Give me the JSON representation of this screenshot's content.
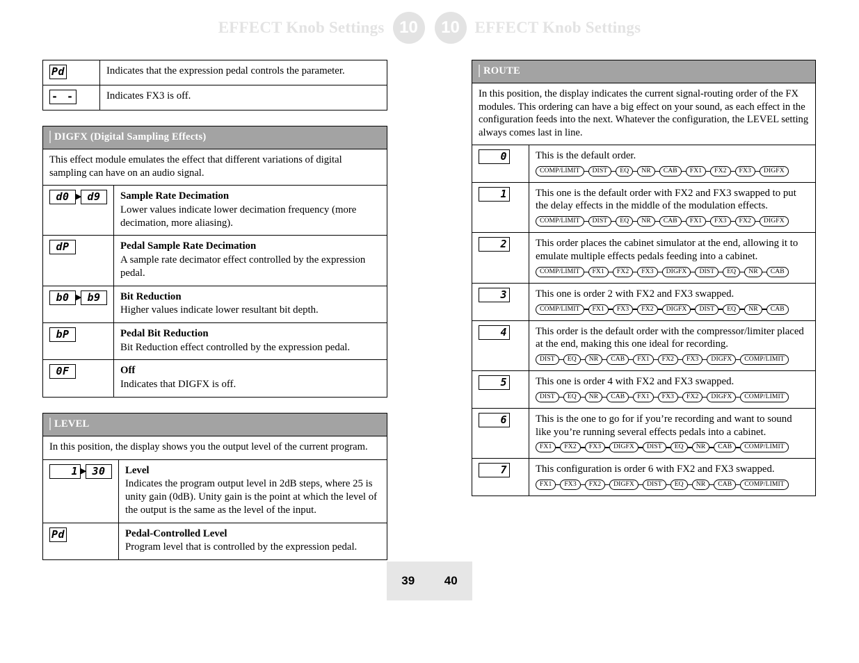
{
  "header": {
    "left_title": "EFFECT Knob Settings",
    "right_title": "EFFECT Knob Settings",
    "badge_left": "10",
    "badge_right": "10",
    "badge_color": "#e3e3e3",
    "title_color": "#e3e3e3"
  },
  "footer": {
    "page_left": "39",
    "page_right": "40",
    "background": "#e6e6e6"
  },
  "left_column": {
    "top_table": {
      "rows": [
        {
          "symbol": "Pd",
          "symbol_type": "single",
          "description": "Indicates that the expression pedal controls the parameter."
        },
        {
          "symbol": "- -",
          "symbol_type": "dashes",
          "description": "Indicates FX3 is off."
        }
      ]
    },
    "digfx": {
      "heading": "DIGFX (Digital Sampling Effects)",
      "heading_bg": "#a3a3a3",
      "intro": "This effect module emulates the effect that different variations of digital sampling can have on an audio signal.",
      "rows": [
        {
          "symbol_from": "d0",
          "symbol_to": "d9",
          "symbol_type": "range",
          "term": "Sample Rate Decimation",
          "desc": "Lower values indicate lower decimation frequency (more decimation, more aliasing)."
        },
        {
          "symbol": "dP",
          "symbol_type": "single",
          "term": "Pedal Sample Rate Decimation",
          "desc": "A sample rate decimator effect controlled by the expression pedal."
        },
        {
          "symbol_from": "b0",
          "symbol_to": "b9",
          "symbol_type": "range",
          "term": "Bit Reduction",
          "desc": "Higher values indicate lower resultant bit depth."
        },
        {
          "symbol": "bP",
          "symbol_type": "single",
          "term": "Pedal Bit Reduction",
          "desc": "Bit Reduction effect controlled by the expression pedal."
        },
        {
          "symbol": "0F",
          "symbol_type": "single",
          "term": "Off",
          "desc": "Indicates that DIGFX is off."
        }
      ]
    },
    "level": {
      "heading": "LEVEL",
      "heading_bg": "#a3a3a3",
      "intro": "In this position, the display shows you the output level of the current program.",
      "rows": [
        {
          "symbol_from": "1",
          "symbol_to": "30",
          "symbol_type": "range_padded",
          "term": "Level",
          "desc": "Indicates the program output level in 2dB steps, where 25 is unity gain (0dB). Unity gain is the point at which the level of the output is the same as the level of the input."
        },
        {
          "symbol": "Pd",
          "symbol_type": "single",
          "term": "Pedal-Controlled Level",
          "desc": "Program level that is controlled by the expression pedal."
        }
      ]
    }
  },
  "right_column": {
    "route": {
      "heading": "ROUTE",
      "heading_bg": "#a3a3a3",
      "intro": "In this position, the display indicates the current signal-routing order of the FX modules. This ordering can have a big effect on your sound, as each effect in the configuration feeds into the next. Whatever the configuration, the LEVEL setting always comes last in line.",
      "rows": [
        {
          "symbol": "0",
          "desc": "This is the default order.",
          "chain": [
            "COMP/LIMIT",
            "DIST",
            "EQ",
            "NR",
            "CAB",
            "FX1",
            "FX2",
            "FX3",
            "DIGFX"
          ]
        },
        {
          "symbol": "1",
          "desc": "This one is the default order with FX2 and FX3 swapped to put the delay effects in the middle of the modulation effects.",
          "chain": [
            "COMP/LIMIT",
            "DIST",
            "EQ",
            "NR",
            "CAB",
            "FX1",
            "FX3",
            "FX2",
            "DIGFX"
          ]
        },
        {
          "symbol": "2",
          "desc": "This order places the cabinet simulator at the end, allowing it to emulate multiple effects pedals feeding into a cabinet.",
          "chain": [
            "COMP/LIMIT",
            "FX1",
            "FX2",
            "FX3",
            "DIGFX",
            "DIST",
            "EQ",
            "NR",
            "CAB"
          ]
        },
        {
          "symbol": "3",
          "desc": "This one is order 2 with FX2 and FX3 swapped.",
          "chain": [
            "COMP/LIMIT",
            "FX1",
            "FX3",
            "FX2",
            "DIGFX",
            "DIST",
            "EQ",
            "NR",
            "CAB"
          ]
        },
        {
          "symbol": "4",
          "desc": "This order is the default order with the compressor/limiter placed at the end, making this one ideal for recording.",
          "chain": [
            "DIST",
            "EQ",
            "NR",
            "CAB",
            "FX1",
            "FX2",
            "FX3",
            "DIGFX",
            "COMP/LIMIT"
          ]
        },
        {
          "symbol": "5",
          "desc": "This one is order 4 with FX2 and FX3 swapped.",
          "chain": [
            "DIST",
            "EQ",
            "NR",
            "CAB",
            "FX1",
            "FX3",
            "FX2",
            "DIGFX",
            "COMP/LIMIT"
          ]
        },
        {
          "symbol": "6",
          "desc": "This is the one to go for if you’re recording and want to sound like you’re running several effects pedals into a cabinet.",
          "chain": [
            "FX1",
            "FX2",
            "FX3",
            "DIGFX",
            "DIST",
            "EQ",
            "NR",
            "CAB",
            "COMP/LIMIT"
          ]
        },
        {
          "symbol": "7",
          "desc": "This configuration is order 6 with FX2 and FX3 swapped.",
          "chain": [
            "FX1",
            "FX3",
            "FX2",
            "DIGFX",
            "DIST",
            "EQ",
            "NR",
            "CAB",
            "COMP/LIMIT"
          ]
        }
      ]
    }
  }
}
